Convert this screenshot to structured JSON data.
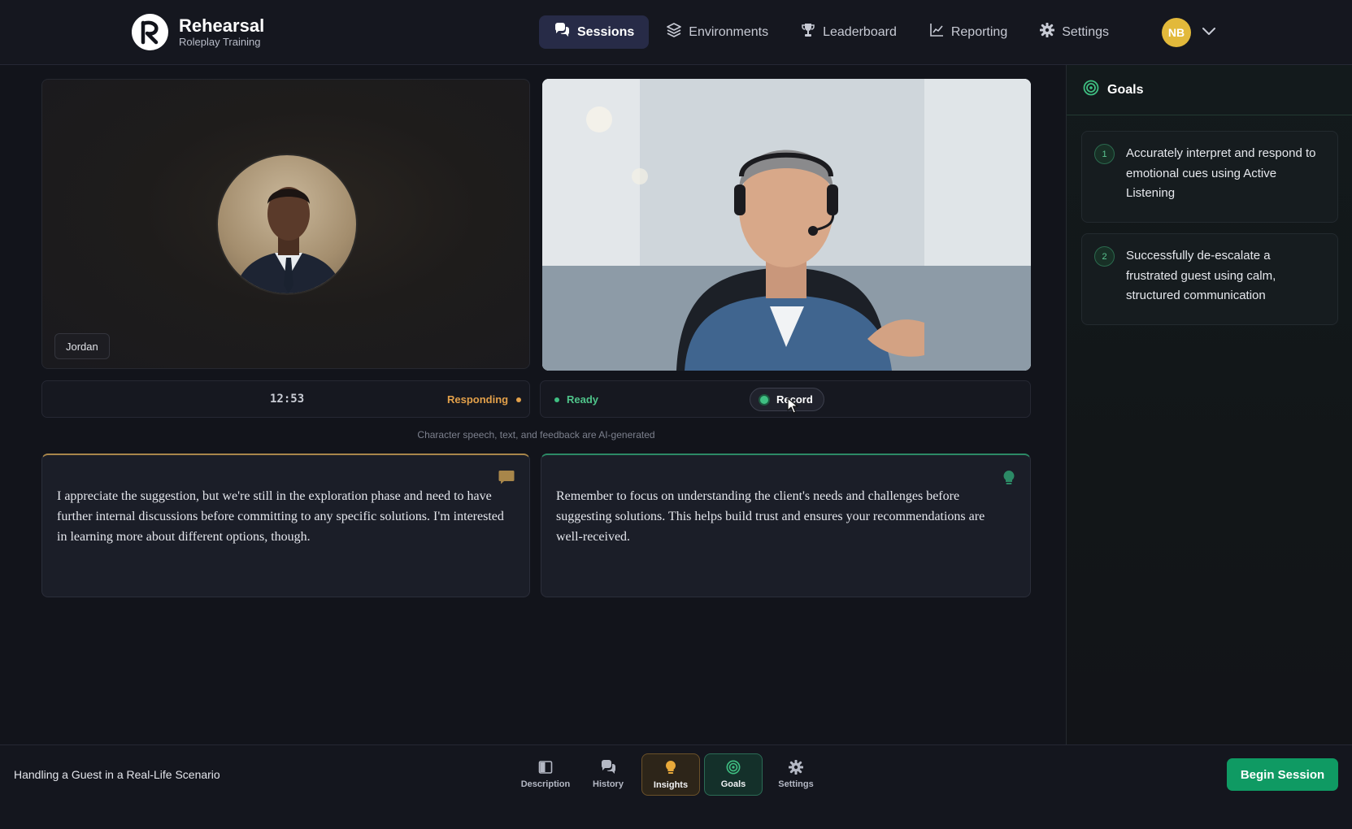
{
  "brand": {
    "name": "Rehearsal",
    "subtitle": "Roleplay Training"
  },
  "nav": {
    "items": [
      {
        "label": "Sessions",
        "icon": "chat-bubbles-icon",
        "active": true
      },
      {
        "label": "Environments",
        "icon": "layers-icon",
        "active": false
      },
      {
        "label": "Leaderboard",
        "icon": "trophy-icon",
        "active": false
      },
      {
        "label": "Reporting",
        "icon": "chart-line-icon",
        "active": false
      },
      {
        "label": "Settings",
        "icon": "gear-icon",
        "active": false
      }
    ]
  },
  "user": {
    "initials": "NB",
    "avatar_color": "#e2b93b"
  },
  "character": {
    "name": "Jordan"
  },
  "session": {
    "timer": "12:53",
    "character_status": "Responding",
    "user_status": "Ready",
    "record_label": "Record",
    "disclaimer": "Character speech, text, and feedback are AI-generated"
  },
  "transcript": {
    "character_message": "I appreciate the suggestion, but we're still in the exploration phase and need to have further internal discussions before committing to any specific solutions. I'm interested in learning more about different options, though.",
    "insight_message": "Remember to focus on understanding the client's needs and challenges before suggesting solutions. This helps build trust and ensures your recommendations are well-received."
  },
  "goals": {
    "title": "Goals",
    "items": [
      {
        "number": "1",
        "text": "Accurately interpret and respond to emotional cues using Active Listening"
      },
      {
        "number": "2",
        "text": "Successfully de-escalate a frustrated guest using calm, structured communication"
      }
    ]
  },
  "bottombar": {
    "scenario": "Handling a Guest in a Real-Life Scenario",
    "tools": [
      {
        "label": "Description",
        "icon": "book-icon"
      },
      {
        "label": "History",
        "icon": "chat-bubbles-icon"
      },
      {
        "label": "Insights",
        "icon": "lightbulb-icon"
      },
      {
        "label": "Goals",
        "icon": "target-icon"
      },
      {
        "label": "Settings",
        "icon": "gear-icon"
      }
    ],
    "begin_label": "Begin Session"
  },
  "colors": {
    "accent_green": "#0f9a63",
    "responding_amber": "#e2a04a",
    "ready_green": "#4fc48a",
    "active_nav": "#272b47"
  }
}
